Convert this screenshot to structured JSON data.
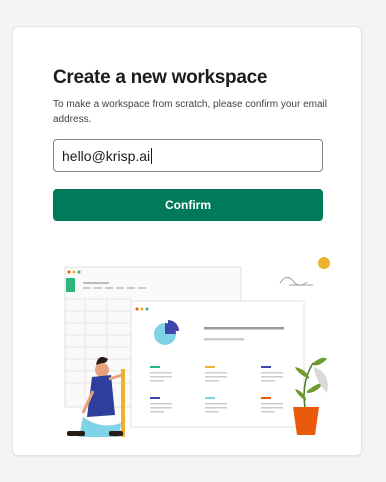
{
  "form": {
    "title": "Create a new workspace",
    "description": "To make a workspace from scratch, please confirm your email address.",
    "email_value": "hello@krisp.ai",
    "confirm_label": "Confirm"
  },
  "colors": {
    "accent": "#007a5a",
    "dot_yellow": "#ecb22e",
    "pot_orange": "#e8590c",
    "pie_blue": "#3f46ad",
    "pie_light": "#7fd3e6"
  },
  "illustration": {
    "icon": "workspace-dashboard-illustration"
  }
}
